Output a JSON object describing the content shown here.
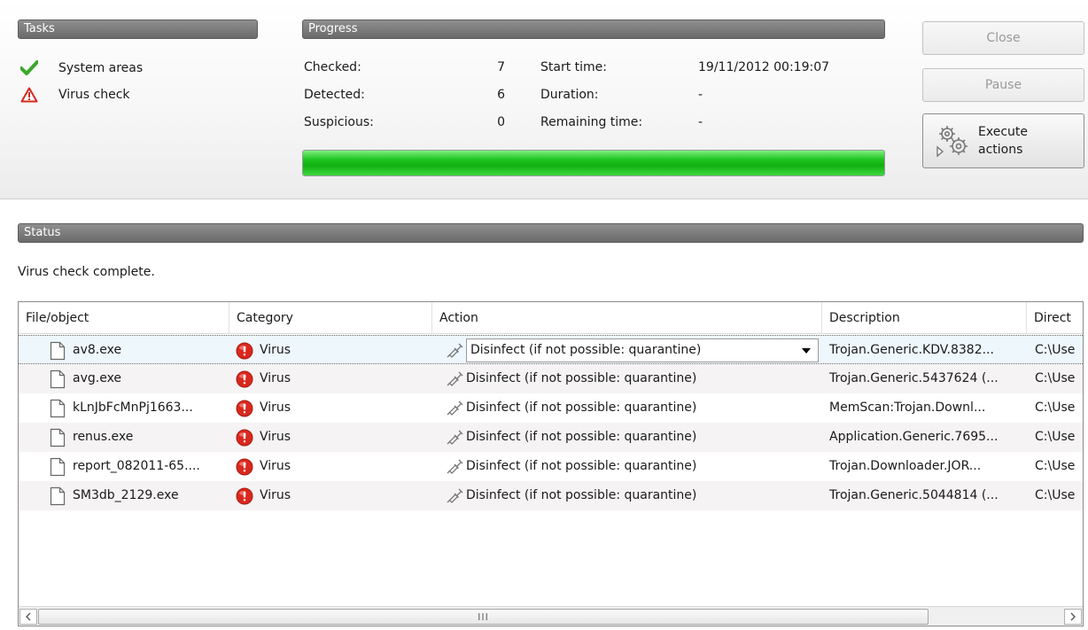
{
  "tasks": {
    "title": "Tasks",
    "items": [
      {
        "label": "System areas",
        "state": "success"
      },
      {
        "label": "Virus check",
        "state": "warning"
      }
    ]
  },
  "progress": {
    "title": "Progress",
    "checked_label": "Checked:",
    "checked_value": "7",
    "detected_label": "Detected:",
    "detected_value": "6",
    "suspicious_label": "Suspicious:",
    "suspicious_value": "0",
    "start_time_label": "Start time:",
    "start_time_value": "19/11/2012 00:19:07",
    "duration_label": "Duration:",
    "duration_value": "-",
    "remaining_label": "Remaining time:",
    "remaining_value": "-",
    "bar_percent": 100,
    "bar_color": "#21c421"
  },
  "buttons": {
    "close": "Close",
    "pause": "Pause",
    "execute_line1": "Execute",
    "execute_line2": "actions"
  },
  "status": {
    "title": "Status",
    "message": "Virus check complete."
  },
  "table": {
    "columns": [
      "File/object",
      "Category",
      "Action",
      "Description",
      "Direct"
    ],
    "rows": [
      {
        "file": "av8.exe",
        "category": "Virus",
        "action": "Disinfect (if not possible: quarantine)",
        "description": "Trojan.Generic.KDV.8382...",
        "directory": "C:\\Use"
      },
      {
        "file": "avg.exe",
        "category": "Virus",
        "action": "Disinfect (if not possible: quarantine)",
        "description": "Trojan.Generic.5437624 (...",
        "directory": "C:\\Use"
      },
      {
        "file": "kLnJbFcMnPj1663...",
        "category": "Virus",
        "action": "Disinfect (if not possible: quarantine)",
        "description": "MemScan:Trojan.Downl...",
        "directory": "C:\\Use"
      },
      {
        "file": "renus.exe",
        "category": "Virus",
        "action": "Disinfect (if not possible: quarantine)",
        "description": "Application.Generic.7695...",
        "directory": "C:\\Use"
      },
      {
        "file": "report_082011-65....",
        "category": "Virus",
        "action": "Disinfect (if not possible: quarantine)",
        "description": "Trojan.Downloader.JOR...",
        "directory": "C:\\Use"
      },
      {
        "file": "SM3db_2129.exe",
        "category": "Virus",
        "action": "Disinfect (if not possible: quarantine)",
        "description": "Trojan.Generic.5044814 (...",
        "directory": "C:\\Use"
      }
    ]
  },
  "scrollbar": {
    "grip": "III"
  },
  "colors": {
    "header_bar": "#7a7a7a",
    "virus_red": "#d9281e",
    "check_green": "#3aa829",
    "warning_red": "#d32a1f"
  }
}
